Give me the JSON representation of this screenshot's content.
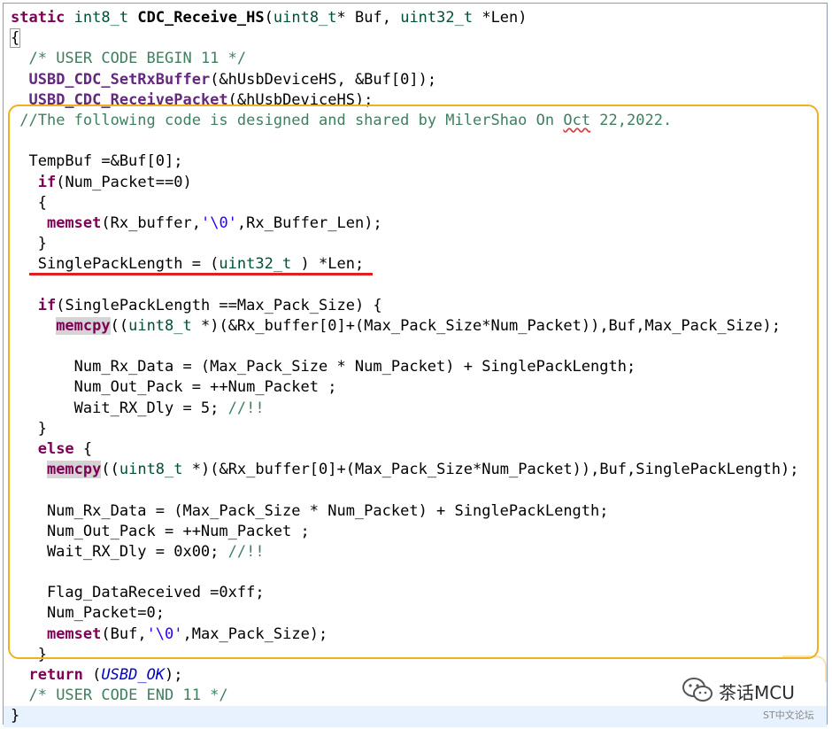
{
  "code_lines": [
    [
      {
        "t": "static",
        "c": "kw"
      },
      {
        "t": " "
      },
      {
        "t": "int8_t",
        "c": "ty"
      },
      {
        "t": " "
      },
      {
        "t": "CDC_Receive_HS",
        "c": "fn"
      },
      {
        "t": "("
      },
      {
        "t": "uint8_t",
        "c": "ty"
      },
      {
        "t": "* Buf, "
      },
      {
        "t": "uint32_t",
        "c": "ty"
      },
      {
        "t": " *Len)"
      }
    ],
    [
      {
        "t": "{",
        "c": "dot-brace"
      }
    ],
    [
      {
        "t": "  "
      },
      {
        "t": "/* USER CODE BEGIN 11 */",
        "c": "cm"
      }
    ],
    [
      {
        "t": "  "
      },
      {
        "t": "USBD_CDC_SetRxBuffer",
        "c": "fnp"
      },
      {
        "t": "(&hUsbDeviceHS, &Buf[0]);"
      }
    ],
    [
      {
        "t": "  "
      },
      {
        "t": "USBD_CDC_ReceivePacket",
        "c": "fnp"
      },
      {
        "t": "(&hUsbDeviceHS);"
      }
    ],
    [
      {
        "t": " "
      },
      {
        "t": "//The following code is designed and shared by MilerShao On ",
        "c": "cm"
      },
      {
        "t": "Oct",
        "c": "cm sq"
      },
      {
        "t": " 22,2022.",
        "c": "cm"
      }
    ],
    [],
    [
      {
        "t": "  TempBuf =&Buf[0];"
      }
    ],
    [
      {
        "t": "   "
      },
      {
        "t": "if",
        "c": "kw"
      },
      {
        "t": "(Num_Packet==0)"
      }
    ],
    [
      {
        "t": "   {"
      }
    ],
    [
      {
        "t": "    "
      },
      {
        "t": "memset",
        "c": "kw"
      },
      {
        "t": "(Rx_buffer,"
      },
      {
        "t": "'\\0'",
        "c": "st"
      },
      {
        "t": ",Rx_Buffer_Len);"
      }
    ],
    [
      {
        "t": "   }"
      }
    ],
    [
      {
        "t": "   SinglePackLength = ("
      },
      {
        "t": "uint32_t",
        "c": "ty"
      },
      {
        "t": " ) *Len;"
      }
    ],
    [],
    [
      {
        "t": "   "
      },
      {
        "t": "if",
        "c": "kw"
      },
      {
        "t": "(SinglePackLength ==Max_Pack_Size) {"
      }
    ],
    [
      {
        "t": "     "
      },
      {
        "t": "memcpy",
        "c": "kw hl"
      },
      {
        "t": "(("
      },
      {
        "t": "uint8_t",
        "c": "ty"
      },
      {
        "t": " *)(&Rx_buffer[0]+(Max_Pack_Size*Num_Packet)),Buf,Max_Pack_Size);"
      }
    ],
    [],
    [
      {
        "t": "       Num_Rx_Data = (Max_Pack_Size * Num_Packet) + SinglePackLength;"
      }
    ],
    [
      {
        "t": "       Num_Out_Pack = ++Num_Packet ;"
      }
    ],
    [
      {
        "t": "       Wait_RX_Dly = 5; "
      },
      {
        "t": "//!!",
        "c": "cm"
      }
    ],
    [
      {
        "t": "   }"
      }
    ],
    [
      {
        "t": "   "
      },
      {
        "t": "else",
        "c": "kw"
      },
      {
        "t": " {"
      }
    ],
    [
      {
        "t": "    "
      },
      {
        "t": "memcpy",
        "c": "kw hl"
      },
      {
        "t": "(("
      },
      {
        "t": "uint8_t",
        "c": "ty"
      },
      {
        "t": " *)(&Rx_buffer[0]+(Max_Pack_Size*Num_Packet)),Buf,SinglePackLength);"
      }
    ],
    [],
    [
      {
        "t": "    Num_Rx_Data = (Max_Pack_Size * Num_Packet) + SinglePackLength;"
      }
    ],
    [
      {
        "t": "    Num_Out_Pack = ++Num_Packet ;"
      }
    ],
    [
      {
        "t": "    Wait_RX_Dly = 0x00; "
      },
      {
        "t": "//!!",
        "c": "cm"
      }
    ],
    [],
    [
      {
        "t": "    Flag_DataReceived =0xff;"
      }
    ],
    [
      {
        "t": "    Num_Packet=0;"
      }
    ],
    [
      {
        "t": "    "
      },
      {
        "t": "memset",
        "c": "kw"
      },
      {
        "t": "(Buf,"
      },
      {
        "t": "'\\0'",
        "c": "st"
      },
      {
        "t": ",Max_Pack_Size);"
      }
    ],
    [
      {
        "t": "   }"
      }
    ],
    [
      {
        "t": "  "
      },
      {
        "t": "return",
        "c": "kw"
      },
      {
        "t": " ("
      },
      {
        "t": "USBD_OK",
        "c": "ital"
      },
      {
        "t": ");"
      }
    ],
    [
      {
        "t": "  "
      },
      {
        "t": "/* USER CODE END 11 */",
        "c": "cm"
      }
    ],
    [
      {
        "t": "}"
      }
    ]
  ],
  "colors": {
    "keyword": "#7f0055",
    "type": "#005032",
    "comment": "#3f7f5f",
    "string": "#2a00ff",
    "highlight_box": "#f0b020",
    "underline": "#e02020"
  },
  "watermark": {
    "icon": "wechat-icon",
    "name": "茶话MCU",
    "sub": "ST中文论坛"
  }
}
